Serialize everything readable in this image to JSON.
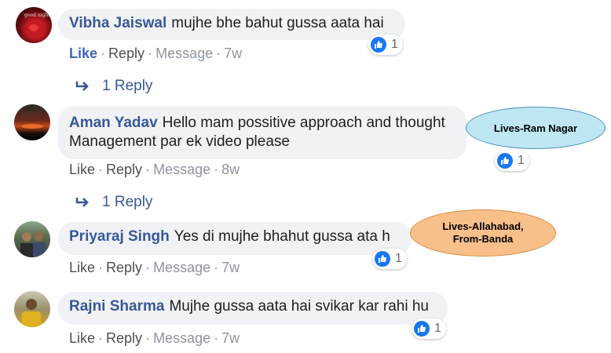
{
  "comments": [
    {
      "author": "Vibha Jaiswal",
      "text": "mujhe bhe bahut gussa aata hai",
      "text_line2": "",
      "reactions": "1",
      "actions": {
        "like": "Like",
        "reply": "Reply",
        "message": "Message",
        "time": "7w"
      },
      "replies": "1 Reply"
    },
    {
      "author": "Aman Yadav",
      "text": "Hello mam possitive approach and thought",
      "text_line2": "Management par ek video please",
      "reactions": "1",
      "actions": {
        "like": "Like",
        "reply": "Reply",
        "message": "Message",
        "time": "8w"
      },
      "replies": "1 Reply"
    },
    {
      "author": "Priyaraj Singh",
      "text": "Yes di mujhe bhahut gussa ata h",
      "text_line2": "",
      "reactions": "1",
      "actions": {
        "like": "Like",
        "reply": "Reply",
        "message": "Message",
        "time": "7w"
      },
      "replies": ""
    },
    {
      "author": "Rajni Sharma",
      "text": "Mujhe gussa aata hai svikar kar rahi hu",
      "text_line2": "",
      "reactions": "1",
      "actions": {
        "like": "Like",
        "reply": "Reply",
        "message": "Message",
        "time": "7w"
      },
      "replies": ""
    }
  ],
  "callouts": {
    "aman": {
      "text": "Lives-Ram Nagar",
      "color": "#bfe6f3"
    },
    "priyaraj": {
      "line1": "Lives-Allahabad,",
      "line2": "From-Banda",
      "color": "#f7c08b"
    }
  },
  "colors": {
    "name": "#385898",
    "bubble": "#f0f2f5",
    "like": "#1877f2"
  }
}
